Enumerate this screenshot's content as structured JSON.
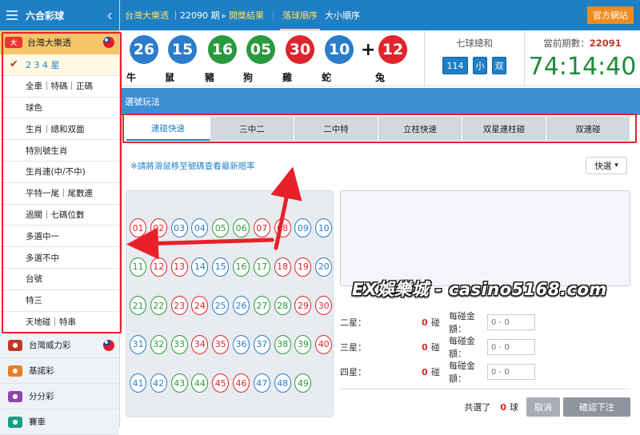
{
  "sidebar": {
    "title": "六合彩球",
    "back_icon": "chevron-left-icon",
    "active_lottery": "台灣大樂透",
    "menu": [
      {
        "label": "2 3 4 星",
        "active": true
      },
      {
        "label": "全車｜特碼｜正碼"
      },
      {
        "label": "球色"
      },
      {
        "label": "生肖｜總和双面"
      },
      {
        "label": "特別號生肖"
      },
      {
        "label": "生肖連(中/不中)"
      },
      {
        "label": "平特一尾｜尾數連"
      },
      {
        "label": "過關｜七碼位數"
      },
      {
        "label": "多選中一"
      },
      {
        "label": "多選不中"
      },
      {
        "label": "台號"
      },
      {
        "label": "特三"
      },
      {
        "label": "天地碰｜特串"
      }
    ],
    "lotteries": [
      "台灣威力彩",
      "基諾彩",
      "分分彩",
      "賽車"
    ]
  },
  "topbar": {
    "breadcrumb": "台灣大樂透",
    "period": "22090 期",
    "results": "開獎結果",
    "tab_drop": "落球順序",
    "tab_size": "大小順序",
    "official": "官方網站"
  },
  "draw": {
    "balls": [
      {
        "num": "26",
        "zodiac": "牛",
        "color": "blue"
      },
      {
        "num": "15",
        "zodiac": "鼠",
        "color": "blue"
      },
      {
        "num": "16",
        "zodiac": "豬",
        "color": "green"
      },
      {
        "num": "05",
        "zodiac": "狗",
        "color": "green"
      },
      {
        "num": "30",
        "zodiac": "雞",
        "color": "red"
      },
      {
        "num": "10",
        "zodiac": "蛇",
        "color": "blue"
      },
      {
        "num": "12",
        "zodiac": "兔",
        "color": "red"
      }
    ],
    "plus": "+",
    "sum_label": "七球總和",
    "sum_value": "114",
    "sum_size": "小",
    "sum_parity": "双",
    "current_label": "當前期數：",
    "current_period": "22091",
    "countdown": "74:14:40"
  },
  "play": {
    "title": "選號玩法",
    "tabs": [
      "連碰快速",
      "三中二",
      "二中特",
      "立柱快速",
      "双星連柱碰",
      "双連碰"
    ],
    "active_tab": 0,
    "hint": "※請將滑鼠移至號碼查看最新賠率",
    "quick": "快選"
  },
  "numbers": {
    "red": [
      "01",
      "02",
      "07",
      "08",
      "12",
      "13",
      "18",
      "19",
      "23",
      "24",
      "29",
      "30",
      "34",
      "35",
      "40",
      "45",
      "46"
    ],
    "blue": [
      "03",
      "04",
      "09",
      "10",
      "14",
      "15",
      "20",
      "25",
      "26",
      "31",
      "36",
      "37",
      "41",
      "42",
      "47",
      "48"
    ],
    "green": [
      "05",
      "06",
      "11",
      "16",
      "17",
      "21",
      "22",
      "27",
      "28",
      "32",
      "33",
      "38",
      "39",
      "43",
      "44",
      "49"
    ]
  },
  "hits": [
    {
      "label": "二星：",
      "count": "0",
      "unit": "碰",
      "amount_label": "每碰金額：",
      "placeholder": "0 - 0"
    },
    {
      "label": "三星：",
      "count": "0",
      "unit": "碰",
      "amount_label": "每碰金額：",
      "placeholder": "0 - 0"
    },
    {
      "label": "四星：",
      "count": "0",
      "unit": "碰",
      "amount_label": "每碰金額：",
      "placeholder": "0 - 0"
    }
  ],
  "footer": {
    "selected_label": "共選了",
    "selected_count": "0",
    "selected_unit": "球",
    "cancel": "取消",
    "confirm": "確認下注"
  },
  "watermark": "EX娛樂城 - casino5168.com",
  "colors": {
    "primary": "#1f7fc4",
    "annotation": "#e8202a",
    "red": "#e0242c",
    "blue": "#2b7cc9",
    "green": "#2a9a3e",
    "timer": "#1e8b3c"
  }
}
